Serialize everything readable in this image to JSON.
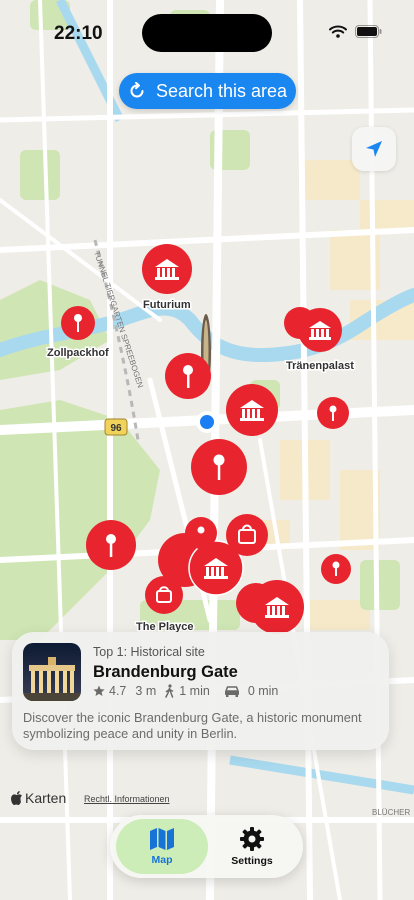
{
  "status_bar": {
    "time": "22:10"
  },
  "search_button": {
    "label": "Search this area"
  },
  "map_labels": {
    "futurium": "Futurium",
    "zollpackhof": "Zollpackhof",
    "traenenpalast": "Tränenpalast",
    "the_playce": "The Playce",
    "tunnel": "TUNNEL TIERGARTEN SPREEBOGEN",
    "road_96": "96",
    "bluecher": "BLÜCHER"
  },
  "place_card": {
    "subtitle": "Top 1: Historical site",
    "title": "Brandenburg Gate",
    "rating": "4.7",
    "distance": "3 m",
    "walk_time": "1 min",
    "drive_time": "0 min",
    "description": "Discover the iconic Brandenburg Gate, a historic monument symbolizing peace and unity in Berlin."
  },
  "attribution": {
    "brand": "Karten",
    "legal": "Rechtl. Informationen"
  },
  "tab_bar": {
    "map_label": "Map",
    "settings_label": "Settings"
  },
  "colors": {
    "accent": "#1a86f0",
    "marker": "#e8252f",
    "user_dot": "#1b7ef2",
    "tab_active": "#ccedb7"
  },
  "markers": [
    {
      "type": "museum"
    },
    {
      "type": "museum"
    },
    {
      "type": "museum"
    },
    {
      "type": "museum"
    },
    {
      "type": "museum"
    },
    {
      "type": "museum"
    },
    {
      "type": "pin"
    },
    {
      "type": "pin"
    },
    {
      "type": "pin"
    },
    {
      "type": "pin"
    },
    {
      "type": "pin"
    },
    {
      "type": "pin"
    },
    {
      "type": "pin"
    },
    {
      "type": "shopping"
    },
    {
      "type": "shopping"
    }
  ]
}
